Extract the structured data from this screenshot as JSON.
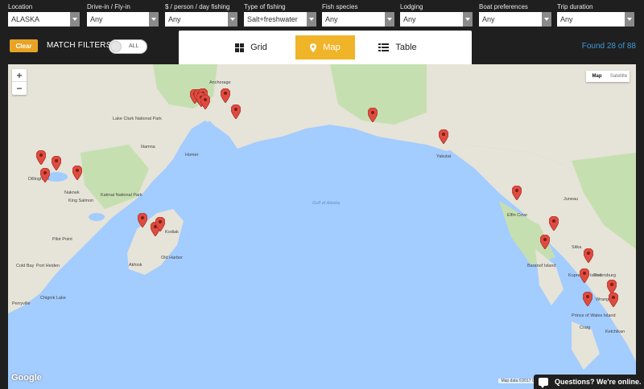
{
  "filters": [
    {
      "label": "Location",
      "value": "ALASKA"
    },
    {
      "label": "Drive-in / Fly-in",
      "value": "Any"
    },
    {
      "label": "$ / person / day fishing",
      "value": "Any"
    },
    {
      "label": "Type of fishing",
      "value": "Salt+freshwater"
    },
    {
      "label": "Fish species",
      "value": "Any"
    },
    {
      "label": "Lodging",
      "value": "Any"
    },
    {
      "label": "Boat preferences",
      "value": "Any"
    },
    {
      "label": "Trip duration",
      "value": "Any"
    }
  ],
  "controls": {
    "clear_label": "Clear",
    "match_label": "MATCH FILTERS:",
    "toggle_text": "ALL"
  },
  "view_tabs": [
    {
      "label": "Grid",
      "icon": "grid-icon"
    },
    {
      "label": "Map",
      "icon": "map-pin-icon",
      "active": true
    },
    {
      "label": "Table",
      "icon": "list-icon"
    }
  ],
  "found": "Found 28 of 88",
  "map": {
    "zoom_in": "+",
    "zoom_out": "−",
    "type_map": "Map",
    "type_satellite": "Satellite",
    "places": [
      "Anchorage",
      "Lake Clark National Park",
      "Katmai National Park",
      "King Salmon",
      "Dillingham",
      "Naknek",
      "Kodiak",
      "Akhiok",
      "Port Heiden",
      "Perryville",
      "Chignik Lake",
      "Pilot Point",
      "Gulf of Alaska",
      "Yakutat",
      "Juneau",
      "Sitka",
      "Petersburg",
      "Wrangell",
      "Ketchikan",
      "Craig",
      "Baranof Island",
      "Kupreanof Island",
      "Prince of Wales Island",
      "Elfin Cove",
      "Homer",
      "Iliamna",
      "Old Harbor",
      "Cold Bay"
    ],
    "attribution": "Map data ©2017 Google",
    "logo": "Google"
  },
  "chat": "Questions? We're online.",
  "colors": {
    "accent": "#f0b429",
    "marker": "#e04b3f",
    "water": "#a3ccff",
    "land": "#e6e3d8"
  }
}
